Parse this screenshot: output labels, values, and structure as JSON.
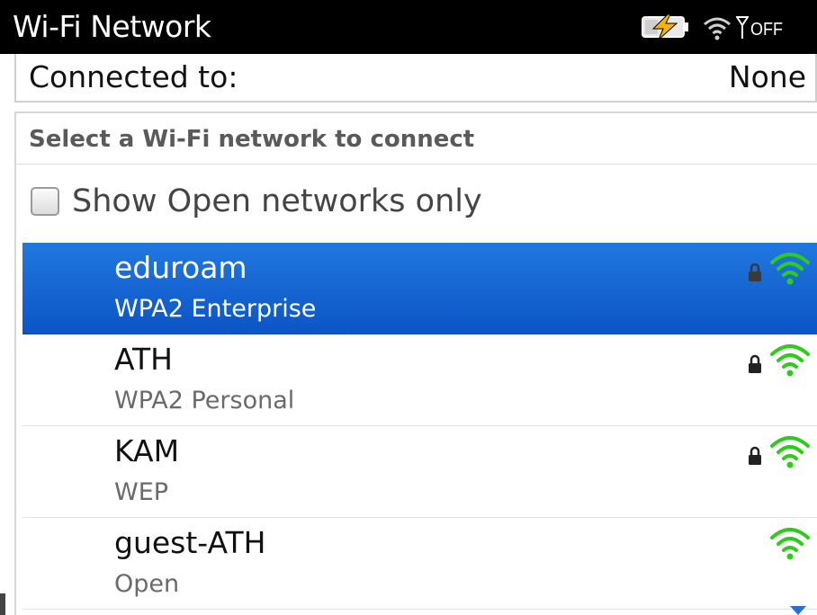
{
  "header": {
    "title": "Wi-Fi Network",
    "battery_icon": "battery-charging-icon",
    "wifi_icon": "wifi-icon",
    "radio_icon": "radio-antenna-icon",
    "radio_status": "OFF"
  },
  "connection": {
    "label": "Connected to:",
    "value": "None"
  },
  "panel": {
    "header": "Select a Wi-Fi network to connect",
    "filter": {
      "label": "Show Open networks only",
      "checked": false
    },
    "networks": [
      {
        "name": "eduroam",
        "security": "WPA2 Enterprise",
        "locked": true,
        "selected": true
      },
      {
        "name": "ATH",
        "security": "WPA2 Personal",
        "locked": true,
        "selected": false
      },
      {
        "name": "KAM",
        "security": "WEP",
        "locked": true,
        "selected": false
      },
      {
        "name": "guest-ATH",
        "security": "Open",
        "locked": false,
        "selected": false
      }
    ]
  },
  "colors": {
    "title_bar": "#000000",
    "selection": "#1a66d6",
    "signal": "#2ecc1a",
    "charging_bolt": "#f5b400"
  }
}
